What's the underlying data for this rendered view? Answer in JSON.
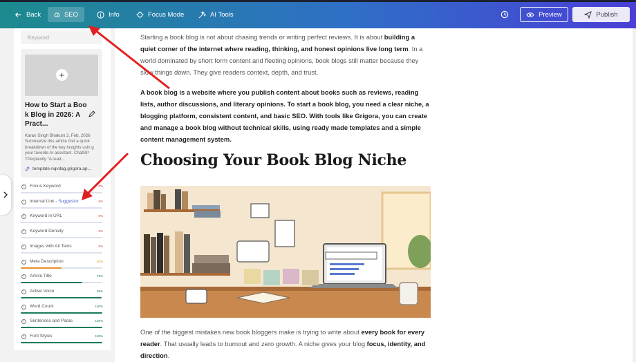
{
  "toolbar": {
    "back_label": "Back",
    "tabs": [
      {
        "label": "SEO",
        "icon": "gauge-icon",
        "active": true
      },
      {
        "label": "Info",
        "icon": "info-icon",
        "active": false
      },
      {
        "label": "Focus Mode",
        "icon": "focus-icon",
        "active": false
      },
      {
        "label": "AI Tools",
        "icon": "sparkle-icon",
        "active": false
      }
    ],
    "preview_label": "Preview",
    "publish_label": "Publish"
  },
  "seo_panel": {
    "keyword_placeholder": "Keyword",
    "post_card": {
      "title": "How to Start a Boo k Blog in 2026: A Pract...",
      "description": "Karan Singh Bhakuni 3, Feb, 2026 Summarize this article Get a quick breakdown of the key insights usin g your favorite AI assistant. ChatGP TPerplexity “A read...",
      "url": "template-nqvdag.grigora.ap..."
    },
    "metrics": [
      {
        "label": "Focus Keyword",
        "extra": "",
        "pct": "0%",
        "value": 0,
        "color": "#d33"
      },
      {
        "label": "Internal Link",
        "extra": "- Suggestor",
        "pct": "0%",
        "value": 0,
        "color": "#d33"
      },
      {
        "label": "Keyword in URL",
        "extra": "",
        "pct": "0%",
        "value": 0,
        "color": "#d33"
      },
      {
        "label": "Keyword Density",
        "extra": "",
        "pct": "0%",
        "value": 0,
        "color": "#d33"
      },
      {
        "label": "Images with Alt Texts",
        "extra": "",
        "pct": "0%",
        "value": 0,
        "color": "#d33"
      },
      {
        "label": "Meta Description",
        "extra": "",
        "pct": "50%",
        "value": 50,
        "color": "#e8902a"
      },
      {
        "label": "Article Title",
        "extra": "",
        "pct": "75%",
        "value": 75,
        "color": "#1c7a5a"
      },
      {
        "label": "Active Voice",
        "extra": "",
        "pct": "99%",
        "value": 99,
        "color": "#1c7a5a"
      },
      {
        "label": "Word Count",
        "extra": "",
        "pct": "100%",
        "value": 100,
        "color": "#1c7a5a"
      },
      {
        "label": "Sentences and Paras",
        "extra": "",
        "pct": "100%",
        "value": 100,
        "color": "#1c7a5a"
      },
      {
        "label": "Font Styles",
        "extra": "",
        "pct": "100%",
        "value": 100,
        "color": "#1c7a5a"
      }
    ]
  },
  "article": {
    "p1_a": "Starting a book blog is not about chasing trends or writing perfect reviews. It is about ",
    "p1_b": "building a quiet corner of the internet where reading, thinking, and honest opinions live long term",
    "p1_c": ". In a world dominated by short form content and fleeting opinions, book blogs still matter because they slow things down. They give readers context, depth, and trust.",
    "p2": "A book blog is a website where you publish content about books such as reviews, reading lists, author discussions, and literary opinions. To start a book blog, you need a clear niche, a blogging platform, consistent content, and basic SEO. With tools like Grigora, you can create and manage a book blog without technical skills, using ready made templates and a simple content management system.",
    "heading": "Choosing Your Book Blog Niche",
    "illustration": {
      "shelf_labels": [
        "FANTASY",
        "ROMANCE",
        "NONFICTION",
        "THRILLERS"
      ],
      "sticky_notes": [
        "NICHE",
        "AUDIENCE",
        "SEO",
        "PUBLISHING"
      ],
      "notebook": "BLOG IDEAS",
      "search_query": "book blog niche ideas"
    },
    "p3_a": "One of the biggest mistakes new book bloggers make is trying to write about ",
    "p3_b": "every book for every reader",
    "p3_c": ". That usually leads to burnout and zero growth. A niche gives your blog ",
    "p3_d": "focus, identity, and direction",
    "p3_e": "."
  },
  "colors": {
    "topbar_start": "#1c8a8e",
    "topbar_end": "#4a3fd6",
    "annotation_arrow": "#e02020"
  }
}
